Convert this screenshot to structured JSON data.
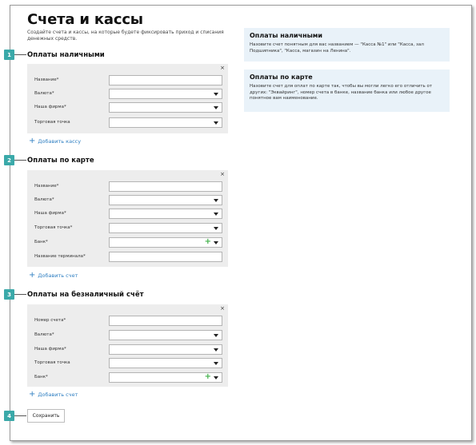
{
  "page": {
    "title": "Счета и кассы",
    "description": "Создайте счета и кассы, на которые будете фиксировать приход и списания денежных средств."
  },
  "sections": [
    {
      "marker": "1",
      "heading": "Оплаты наличными",
      "close": "×",
      "fields": [
        {
          "label": "Название*",
          "type": "text"
        },
        {
          "label": "Валюта*",
          "type": "select"
        },
        {
          "label": "Наша фирма*",
          "type": "select"
        },
        {
          "label": "Торговая точка",
          "type": "select"
        }
      ],
      "add_label": "Добавить кассу"
    },
    {
      "marker": "2",
      "heading": "Оплаты по карте",
      "close": "×",
      "fields": [
        {
          "label": "Название*",
          "type": "text"
        },
        {
          "label": "Валюта*",
          "type": "select"
        },
        {
          "label": "Наша фирма*",
          "type": "select"
        },
        {
          "label": "Торговая точка*",
          "type": "select"
        },
        {
          "label": "Банк*",
          "type": "select-add"
        },
        {
          "label": "Название терминала*",
          "type": "text"
        }
      ],
      "add_label": "Добавить счет"
    },
    {
      "marker": "3",
      "heading": "Оплаты на безналичный счёт",
      "close": "×",
      "fields": [
        {
          "label": "Номер счета*",
          "type": "text"
        },
        {
          "label": "Валюта*",
          "type": "select"
        },
        {
          "label": "Наша фирма*",
          "type": "select"
        },
        {
          "label": "Торговая точка",
          "type": "select"
        },
        {
          "label": "Банк*",
          "type": "select-add"
        }
      ],
      "add_label": "Добавить счет"
    }
  ],
  "save": {
    "marker": "4",
    "label": "Сохранить"
  },
  "info": [
    {
      "title": "Оплаты наличными",
      "text": "Назовите счет понятным для вас названием — \"Касса №1\" или \"Касса, зал Подшипника\", \"Касса, магазин на Ленина\"."
    },
    {
      "title": "Оплаты по карте",
      "text": "Назовите счет для оплат по карте так, чтобы вы могли легко его отличить от других: \"Эквайринг\", номер счета в банке, название банка или любое другое понятное вам наименование."
    }
  ],
  "colors": {
    "marker": "#3aa9a9",
    "link": "#2f7fc2",
    "add_icon": "#41b24a",
    "info_bg": "#e9f2f9",
    "form_bg": "#ededed"
  }
}
